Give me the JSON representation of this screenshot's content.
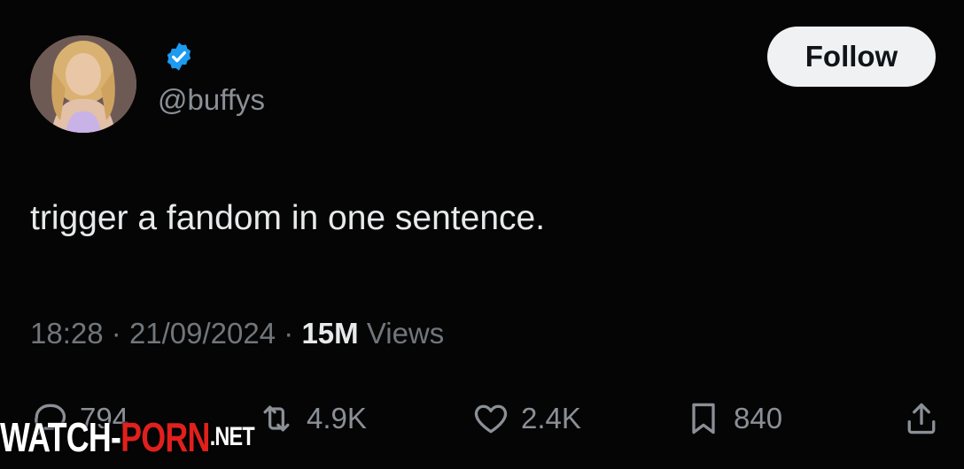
{
  "profile": {
    "handle": "@buffys",
    "verified_color": "#1d9bf0",
    "avatar": "avatar-photo"
  },
  "follow_label": "Follow",
  "tweet": {
    "text": "trigger a fandom in one sentence.",
    "time": "18:28",
    "separator": "·",
    "date": "21/09/2024",
    "views_count": "15M",
    "views_label": "Views"
  },
  "actions": {
    "replies": "794",
    "reposts": "4.9K",
    "likes": "2.4K",
    "bookmarks": "840"
  },
  "watermark": {
    "part1": "WATCH-",
    "part2": "PORN",
    "part3": ".NET"
  },
  "colors": {
    "background": "#050505",
    "text": "#e7e9ea",
    "muted": "#71767b",
    "accent": "#1d9bf0"
  }
}
